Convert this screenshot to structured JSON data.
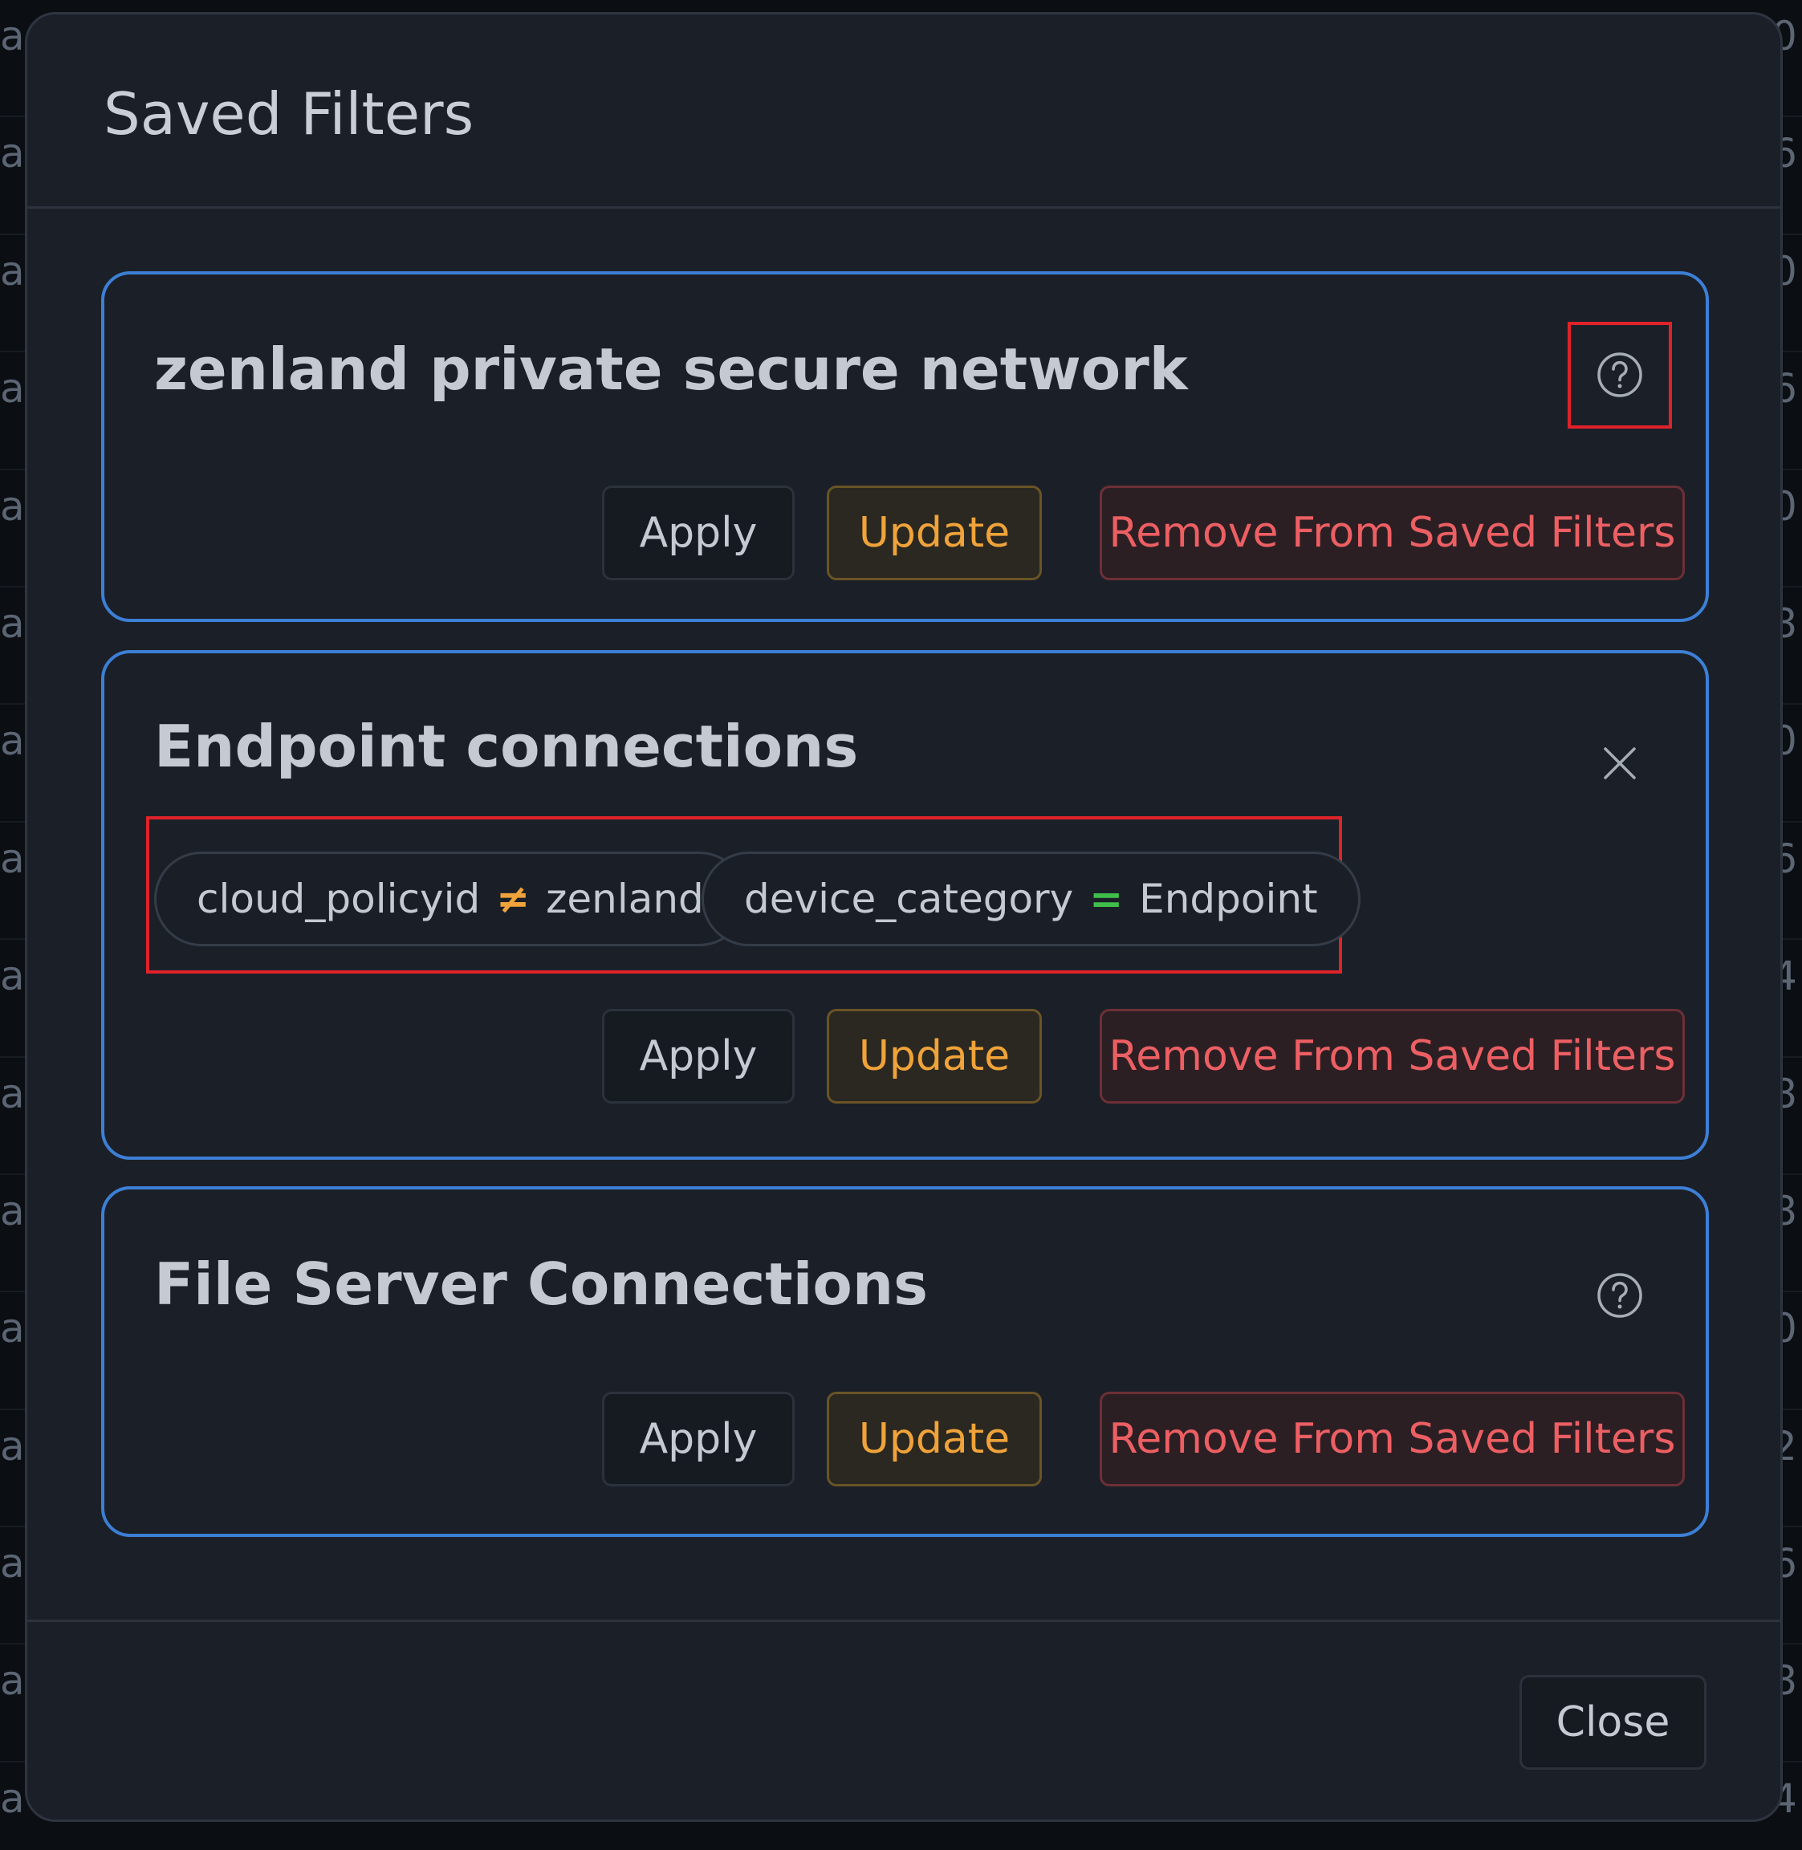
{
  "background": {
    "left_letters": [
      "a",
      "a",
      "a",
      "a",
      "a",
      "a",
      "a",
      "a",
      "a",
      "a",
      "a",
      "a",
      "a",
      "a",
      "a",
      "a"
    ],
    "right_digits": [
      "0",
      "6",
      "0",
      "6",
      "0",
      "8",
      "0",
      "6",
      "4",
      "8",
      "8",
      "0",
      "2",
      "6",
      "8",
      "4"
    ]
  },
  "modal": {
    "title": "Saved Filters",
    "close_label": "Close"
  },
  "filters": [
    {
      "name": "zenland private secure network",
      "icon": "help-circle-icon",
      "chips": [],
      "apply_label": "Apply",
      "update_label": "Update",
      "remove_label": "Remove From Saved Filters"
    },
    {
      "name": "Endpoint connections",
      "icon": "close-icon",
      "chips": [
        {
          "field": "cloud_policyid",
          "op": "≠",
          "value": "zenland"
        },
        {
          "field": "device_category",
          "op": "=",
          "value": "Endpoint"
        }
      ],
      "apply_label": "Apply",
      "update_label": "Update",
      "remove_label": "Remove From Saved Filters"
    },
    {
      "name": "File Server Connections",
      "icon": "help-circle-icon",
      "chips": [],
      "apply_label": "Apply",
      "update_label": "Update",
      "remove_label": "Remove From Saved Filters"
    }
  ],
  "colors": {
    "card_border": "#3d7fd6",
    "update_text": "#f0a33a",
    "remove_text": "#ec5f63",
    "op_not_equal": "#f0a33a",
    "op_equal": "#3fbf4a",
    "highlight": "#e0222a"
  }
}
